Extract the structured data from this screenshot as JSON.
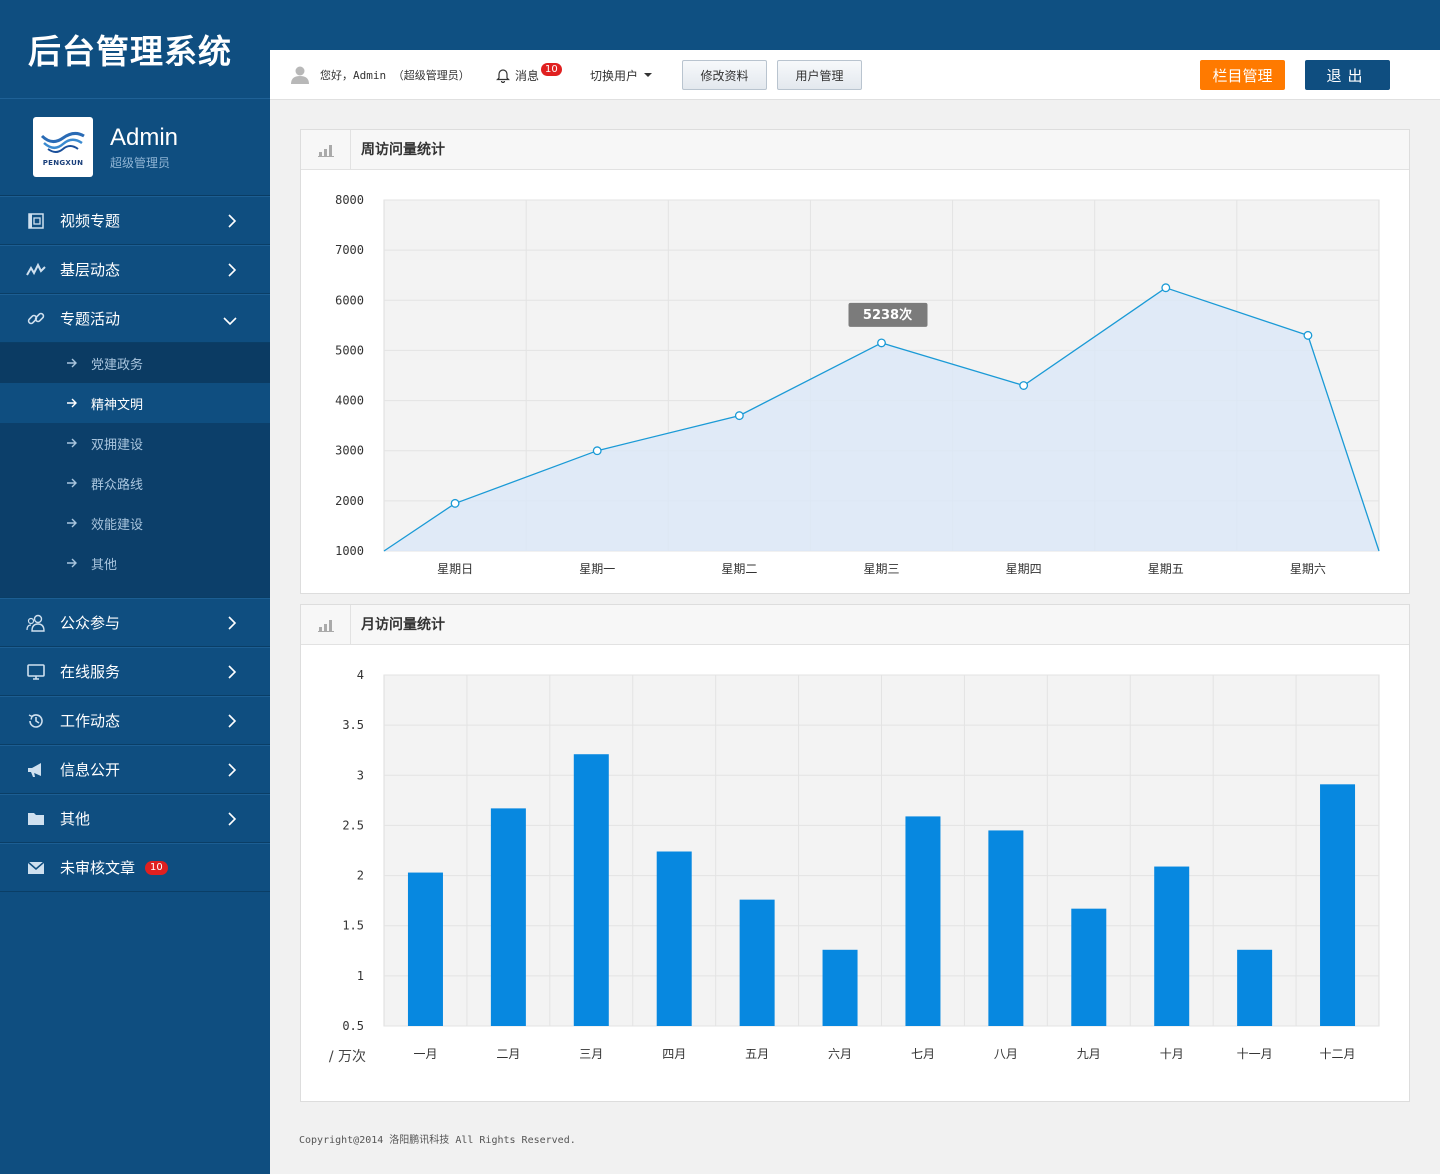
{
  "app": {
    "title": "后台管理系统"
  },
  "profile": {
    "name": "Admin",
    "role": "超级管理员",
    "logo_text": "PENGXUN"
  },
  "sidebar": {
    "items_top": [
      {
        "label": "视频专题",
        "icon": "film-icon"
      },
      {
        "label": "基层动态",
        "icon": "pulse-icon"
      },
      {
        "label": "专题活动",
        "icon": "link-icon",
        "expanded": true
      }
    ],
    "sub_items": [
      {
        "label": "党建政务"
      },
      {
        "label": "精神文明",
        "active": true
      },
      {
        "label": "双拥建设"
      },
      {
        "label": "群众路线"
      },
      {
        "label": "效能建设"
      },
      {
        "label": "其他"
      }
    ],
    "items_bottom": [
      {
        "label": "公众参与",
        "icon": "users-icon"
      },
      {
        "label": "在线服务",
        "icon": "monitor-icon"
      },
      {
        "label": "工作动态",
        "icon": "history-icon"
      },
      {
        "label": "信息公开",
        "icon": "megaphone-icon"
      },
      {
        "label": "其他",
        "icon": "folder-icon"
      },
      {
        "label": "未审核文章",
        "icon": "envelope-icon",
        "badge": "10"
      }
    ]
  },
  "toolbar": {
    "greeting": "您好，Admin （超级管理员）",
    "messages_label": "消息",
    "messages_count": "10",
    "switch_user_label": "切换用户",
    "edit_profile_label": "修改资料",
    "user_manage_label": "用户管理",
    "column_manage_label": "栏目管理",
    "logout_label": "退出"
  },
  "panels": {
    "weekly_title": "周访问量统计",
    "monthly_title": "月访问量统计"
  },
  "chart_data": [
    {
      "type": "area",
      "categories": [
        "星期日",
        "星期一",
        "星期二",
        "星期三",
        "星期四",
        "星期五",
        "星期六"
      ],
      "values": [
        1950,
        3000,
        3700,
        5150,
        4300,
        6250,
        5300
      ],
      "series_start_value": 1000,
      "series_end_value": 1000,
      "ylim": [
        1000,
        8000
      ],
      "yticks": [
        1000,
        2000,
        3000,
        4000,
        5000,
        6000,
        7000,
        8000
      ],
      "tooltip": {
        "category": "星期三",
        "text": "5238次"
      },
      "grid": true,
      "colors": {
        "line": "#1a9ad6",
        "fill": "#dce7f7"
      }
    },
    {
      "type": "bar",
      "categories": [
        "一月",
        "二月",
        "三月",
        "四月",
        "五月",
        "六月",
        "七月",
        "八月",
        "九月",
        "十月",
        "十一月",
        "十二月"
      ],
      "values": [
        2.03,
        2.67,
        3.21,
        2.24,
        1.76,
        1.26,
        2.59,
        2.45,
        1.67,
        2.09,
        1.26,
        2.91
      ],
      "ylim": [
        0.5,
        4
      ],
      "yticks": [
        "0.5",
        "1",
        "1.5",
        "2",
        "2.5",
        "3",
        "3.5",
        "4"
      ],
      "unit_label": "/ 万次",
      "grid": true,
      "colors": {
        "bar": "#0788e0"
      }
    }
  ],
  "footer": {
    "text": "Copyright@2014 洛阳鹏讯科技  All Rights Reserved."
  }
}
